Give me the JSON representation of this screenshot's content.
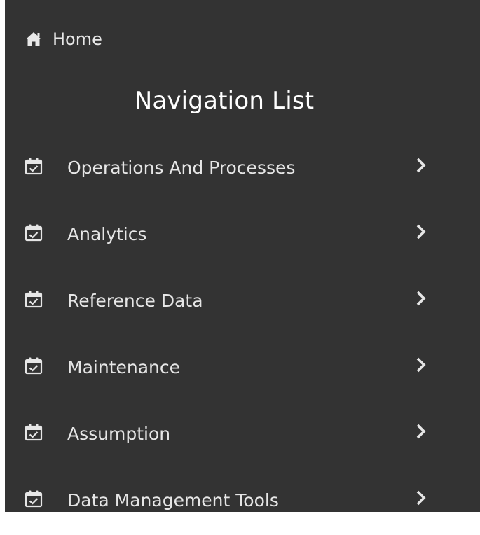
{
  "home": {
    "label": "Home",
    "icon": "home-icon"
  },
  "navigation": {
    "title": "Navigation List",
    "items": [
      {
        "label": "Operations And Processes",
        "icon": "calendar-check-icon"
      },
      {
        "label": "Analytics",
        "icon": "calendar-check-icon"
      },
      {
        "label": "Reference Data",
        "icon": "calendar-check-icon"
      },
      {
        "label": "Maintenance",
        "icon": "calendar-check-icon"
      },
      {
        "label": "Assumption",
        "icon": "calendar-check-icon"
      },
      {
        "label": "Data Management Tools",
        "icon": "calendar-check-icon"
      }
    ]
  },
  "colors": {
    "panel_background": "#333333",
    "text": "#e6e6e6",
    "title": "#ffffff"
  }
}
